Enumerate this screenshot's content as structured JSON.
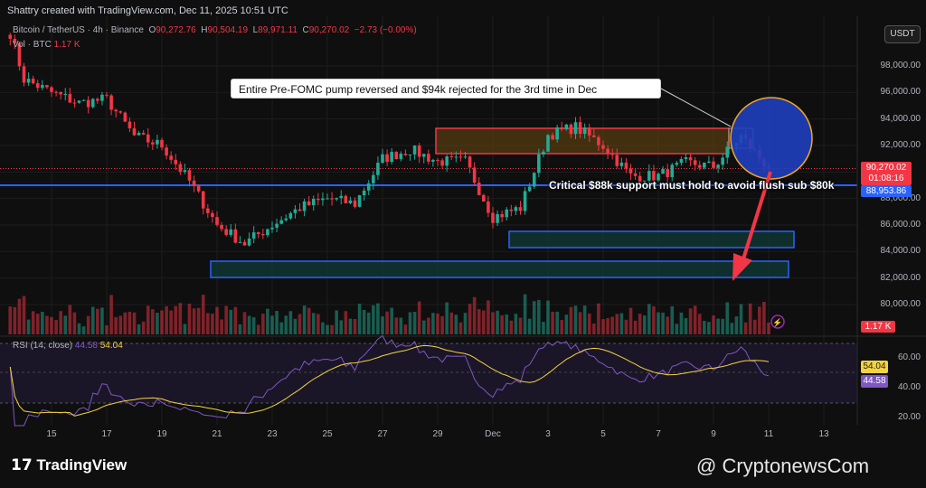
{
  "header": {
    "credit": "Shattry created with TradingView.com, Dec 11, 2025 10:51 UTC"
  },
  "legend": {
    "symbol": "Bitcoin / TetherUS · 4h · Binance",
    "o_label": "O",
    "o": "90,272.76",
    "h_label": "H",
    "h": "90,504.19",
    "l_label": "L",
    "l": "89,971.11",
    "c_label": "C",
    "c": "90,270.02",
    "change": "−2.73 (−0.00%)",
    "vol_label": "Vol · BTC",
    "vol": "1.17 K"
  },
  "currency": "USDT",
  "price_axis": [
    "98,000.00",
    "96,000.00",
    "94,000.00",
    "92,000.00",
    "88,000.00",
    "86,000.00",
    "84,000.00",
    "82,000.00",
    "80,000.00"
  ],
  "tags": {
    "last_price": "90,270.02",
    "countdown": "01:08:16",
    "support": "88,953.86",
    "volume": "1.17 K",
    "rsi_ma": "54.04",
    "rsi": "44.58"
  },
  "rsi": {
    "label": "RSI (14, close)",
    "value": "44.58",
    "ma": "54.04",
    "axis": [
      "60.00",
      "40.00",
      "20.00"
    ]
  },
  "time_axis": [
    "15",
    "17",
    "19",
    "21",
    "23",
    "25",
    "27",
    "29",
    "Dec",
    "3",
    "5",
    "7",
    "9",
    "11",
    "13"
  ],
  "annotations": {
    "callout_top": "Entire Pre-FOMC pump reversed and $94k rejected for the 3rd time in Dec",
    "callout_support": "Critical $88k support must hold to avoid flush sub $80k"
  },
  "footer": {
    "brand": "TradingView",
    "watermark": "@ CryptonewsCom"
  },
  "colors": {
    "up": "#22ab94",
    "down": "#f23645",
    "support": "#2962ff",
    "rsi": "#7e57c2",
    "rsi_ma": "#f5d33f"
  },
  "chart_data": {
    "type": "candlestick",
    "title": "Bitcoin / TetherUS 4h",
    "ylabel": "USDT",
    "ylim": [
      79000,
      100500
    ],
    "daily_close_keypoints": {
      "x": [
        "Nov 13.5",
        "Nov 14",
        "Nov 15",
        "Nov 16",
        "Nov 17",
        "Nov 18",
        "Nov 19",
        "Nov 20",
        "Nov 21",
        "Nov 22",
        "Nov 23",
        "Nov 24",
        "Nov 25",
        "Nov 26",
        "Nov 27",
        "Nov 28",
        "Nov 29",
        "Nov 30",
        "Dec 1",
        "Dec 2",
        "Dec 3",
        "Dec 4",
        "Dec 5",
        "Dec 6",
        "Dec 7",
        "Dec 8",
        "Dec 9",
        "Dec 10",
        "Dec 11"
      ],
      "close": [
        100500,
        97000,
        96000,
        95200,
        95500,
        92700,
        92000,
        89300,
        86000,
        84600,
        86000,
        87300,
        88000,
        87600,
        91000,
        91700,
        90800,
        90800,
        86600,
        87300,
        92800,
        93400,
        92000,
        89700,
        89700,
        90700,
        90400,
        92700,
        90270
      ]
    },
    "levels": {
      "support": 88953.86,
      "resistance_zone": [
        91300,
        93200
      ],
      "demand_zone_1": [
        84300,
        85500
      ],
      "demand_zone_2": [
        82000,
        83200
      ]
    },
    "rsi_range": [
      20,
      70
    ]
  }
}
